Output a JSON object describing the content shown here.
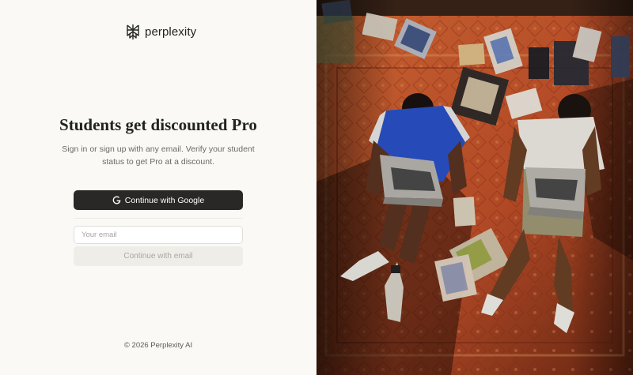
{
  "brand": {
    "name": "perplexity",
    "icon": "perplexity-logo-icon"
  },
  "hero": {
    "title": "Students get discounted Pro",
    "subtitle": "Sign in or sign up with any email. Verify your student status to get Pro at a discount."
  },
  "auth": {
    "google_label": "Continue with Google",
    "google_icon": "google-g-icon",
    "email_placeholder": "Your email",
    "email_value": "",
    "email_button_label": "Continue with email"
  },
  "footer": {
    "copyright": "© 2026 Perplexity AI"
  },
  "colors": {
    "background": "#faf9f6",
    "primary_button": "#2a2826",
    "secondary_button": "#eeede8",
    "rug_orange": "#c2502a"
  }
}
